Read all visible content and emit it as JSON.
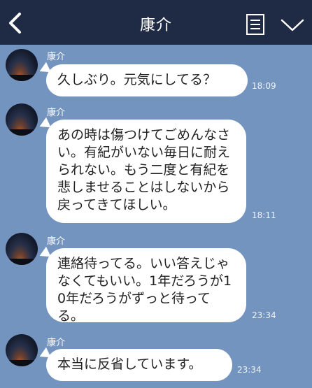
{
  "header": {
    "title": "康介"
  },
  "messages": [
    {
      "sender": "康介",
      "text": "久しぶり。元気にしてる？",
      "time": "18:09"
    },
    {
      "sender": "康介",
      "text": "あの時は傷つけてごめんなさい。有紀がいない毎日に耐えられない。もう二度と有紀を悲しませることはしないから戻ってきてほしい。",
      "time": "18:11"
    },
    {
      "sender": "康介",
      "text": "連絡待ってる。いい答えじゃなくてもいい。1年だろうが10年だろうがずっと待ってる。",
      "time": "23:34"
    },
    {
      "sender": "康介",
      "text": "本当に反省しています。",
      "time": "23:34"
    }
  ],
  "colors": {
    "header_bg": "#1f2a44",
    "chat_bg": "#7494c0",
    "bubble_bg": "#ffffff"
  },
  "icons": {
    "back": "chevron-left-icon",
    "menu": "list-icon",
    "more": "chevron-down-icon"
  }
}
